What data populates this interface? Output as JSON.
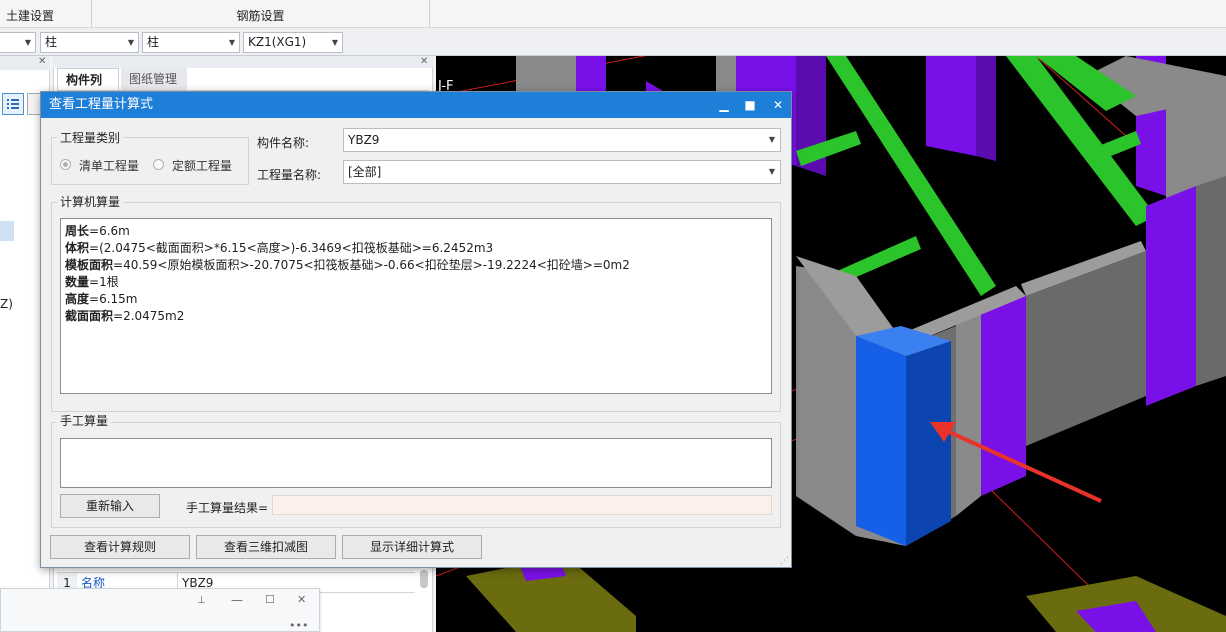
{
  "ribbon": {
    "civil_settings": "土建设置",
    "rebar_settings": "钢筋设置"
  },
  "combos": [
    {
      "value": ""
    },
    {
      "value": "柱"
    },
    {
      "value": "柱"
    },
    {
      "value": "KZ1(XG1)"
    }
  ],
  "left_panel": {
    "partial_text": "Z)"
  },
  "mid_panel": {
    "tabs": [
      "构件列表",
      "图纸管理"
    ],
    "prop_row": {
      "index": "1",
      "key": "名称",
      "value": "YBZ9"
    }
  },
  "viewport": {
    "axis_label": "J-F"
  },
  "dialog": {
    "title": "查看工程量计算式",
    "qty_type_label": "工程量类别",
    "radio_bill": "清单工程量",
    "radio_quota": "定额工程量",
    "component_name_label": "构件名称:",
    "component_name_value": "YBZ9",
    "qty_name_label": "工程量名称:",
    "qty_name_value": "[全部]",
    "computer_calc_label": "计算机算量",
    "lines": [
      {
        "k": "周长",
        "v": "=6.6m"
      },
      {
        "k": "体积",
        "v": "=(2.0475<截面面积>*6.15<高度>)-6.3469<扣筏板基础>=6.2452m3"
      },
      {
        "k": "模板面积",
        "v": "=40.59<原始模板面积>-20.7075<扣筏板基础>-0.66<扣砼垫层>-19.2224<扣砼墙>=0m2"
      },
      {
        "k": "数量",
        "v": "=1根"
      },
      {
        "k": "高度",
        "v": "=6.15m"
      },
      {
        "k": "截面面积",
        "v": "=2.0475m2"
      }
    ],
    "manual_calc_label": "手工算量",
    "reenter_button": "重新输入",
    "manual_result_label": "手工算量结果=",
    "btn_rules": "查看计算规则",
    "btn_3d": "查看三维扣减图",
    "btn_detail": "显示详细计算式"
  },
  "colors": {
    "titlebar": "#1e7fd8",
    "column_blue": "#1560e6",
    "purple": "#7a10e8",
    "green": "#2bc52b",
    "gray_wall": "#8a8a8a",
    "olive": "#6b6b10",
    "arrow_red": "#e8332a"
  }
}
